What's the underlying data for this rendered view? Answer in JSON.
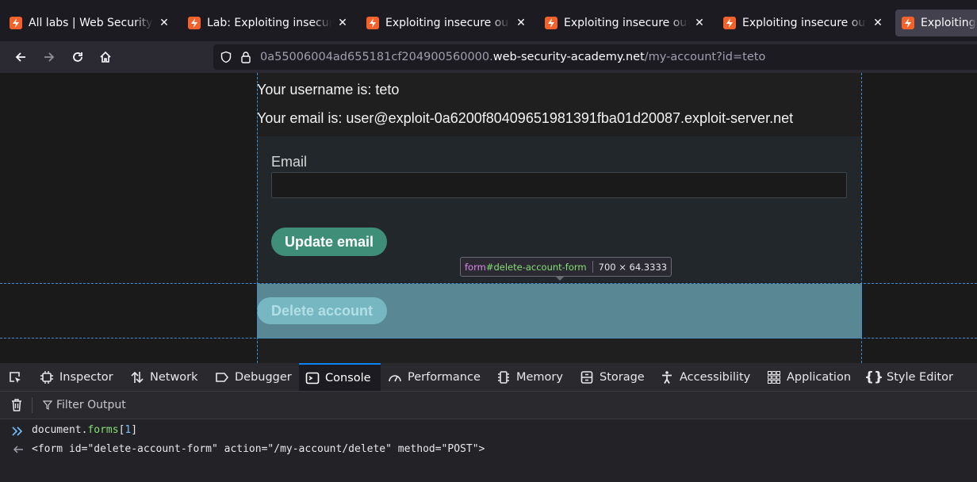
{
  "tabs": [
    {
      "title": "All labs | Web Security Academy",
      "active": false
    },
    {
      "title": "Lab: Exploiting insecure output handling",
      "active": false
    },
    {
      "title": "Exploiting insecure output handling",
      "active": false
    },
    {
      "title": "Exploiting insecure output handling",
      "active": false
    },
    {
      "title": "Exploiting insecure output handling",
      "active": false
    },
    {
      "title": "Exploiting insecure output handling",
      "active": true
    }
  ],
  "address": {
    "prefix": "0a55006004ad655181cf204900560000.",
    "domain": "web-security-academy.net",
    "path": "/my-account?id=teto"
  },
  "page": {
    "username_line": "Your username is: teto",
    "email_line": "Your email is: user@exploit-0a6200f80409651981391fba01d20087.exploit-server.net",
    "email_label": "Email",
    "email_value": "",
    "update_button": "Update email",
    "delete_button": "Delete account"
  },
  "inspector_infobar": {
    "tag": "form",
    "id": "#delete-account-form",
    "dimensions": "700 × 64.3333"
  },
  "devtools": {
    "tabs": [
      "Inspector",
      "Network",
      "Debugger",
      "Console",
      "Performance",
      "Memory",
      "Storage",
      "Accessibility",
      "Application",
      "Style Editor"
    ],
    "active_tab": "Console",
    "filter_placeholder": "Filter Output",
    "console": {
      "input_obj": "document",
      "input_prop": "forms",
      "input_index": "1",
      "output": "<form id=\"delete-account-form\" action=\"/my-account/delete\" method=\"POST\">"
    }
  },
  "colors": {
    "accent": "#0a84ff",
    "brand_favicon": "#f5612b",
    "button_green": "#3f8f78",
    "highlight": "#5a8794"
  }
}
